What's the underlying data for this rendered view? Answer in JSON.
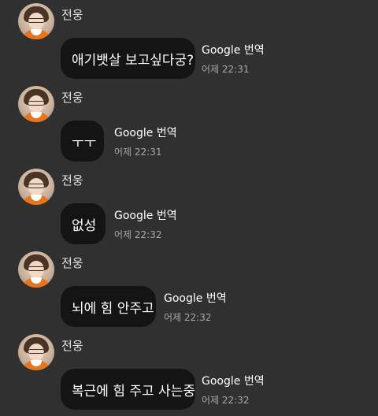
{
  "chat": {
    "messages": [
      {
        "sender": "전웅",
        "text": "애기뱃살 보고싶다궁?",
        "translate_label": "Google 번역",
        "time": "어제 22:31"
      },
      {
        "sender": "전웅",
        "text": "ㅜㅜ",
        "translate_label": "Google 번역",
        "time": "어제 22:31"
      },
      {
        "sender": "전웅",
        "text": "없성",
        "translate_label": "Google 번역",
        "time": "어제 22:32"
      },
      {
        "sender": "전웅",
        "text": "뇌에 힘 안주고",
        "translate_label": "Google 번역",
        "time": "어제 22:32"
      },
      {
        "sender": "전웅",
        "text": "복근에 힘 주고 사는중",
        "translate_label": "Google 번역",
        "time": "어제 22:32"
      }
    ]
  },
  "colors": {
    "background": "#303030",
    "bubble": "#141414",
    "timestamp": "#a8a8a8",
    "avatar_shirt": "#e8741c"
  },
  "icons": [
    "profile-avatar"
  ]
}
